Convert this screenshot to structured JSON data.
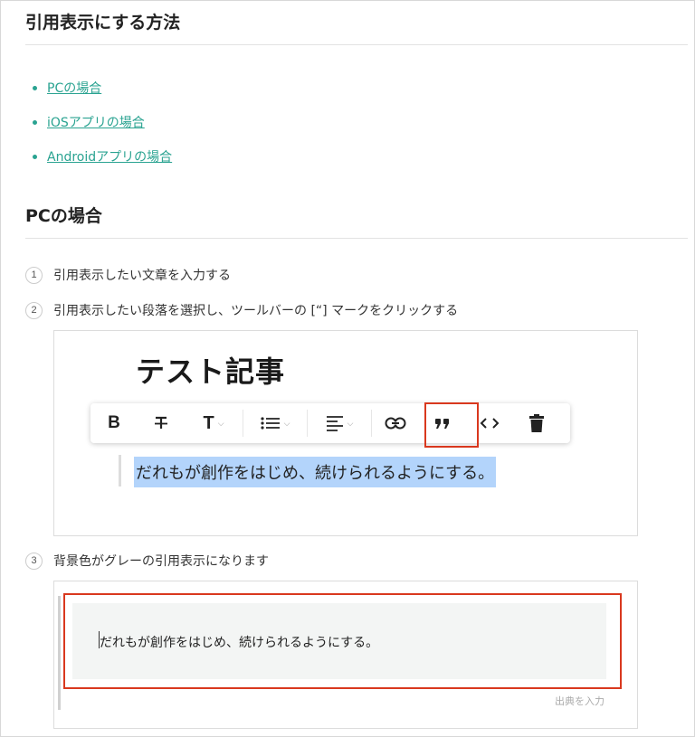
{
  "heading_main": "引用表示にする方法",
  "toc": [
    {
      "label": "PCの場合"
    },
    {
      "label": "iOSアプリの場合"
    },
    {
      "label": "Androidアプリの場合"
    }
  ],
  "heading_pc": "PCの場合",
  "steps": [
    {
      "num": "1",
      "text": "引用表示したい文章を入力する"
    },
    {
      "num": "2",
      "text": "引用表示したい段落を選択し、ツールバーの [“] マークをクリックする"
    },
    {
      "num": "3",
      "text": "背景色がグレーの引用表示になります"
    }
  ],
  "editor": {
    "article_title": "テスト記事",
    "selected_text": "だれもが創作をはじめ、続けられるようにする。",
    "toolbar": {
      "bold": "B",
      "text_style": "T",
      "caret": "⌵"
    }
  },
  "result": {
    "quote_text": "だれもが創作をはじめ、続けられるようにする。",
    "source_placeholder": "出典を入力"
  },
  "colors": {
    "link": "#2aa391",
    "highlight_box": "#d9381e",
    "selection": "#b3d4fb",
    "quote_bg": "#f3f5f4"
  }
}
